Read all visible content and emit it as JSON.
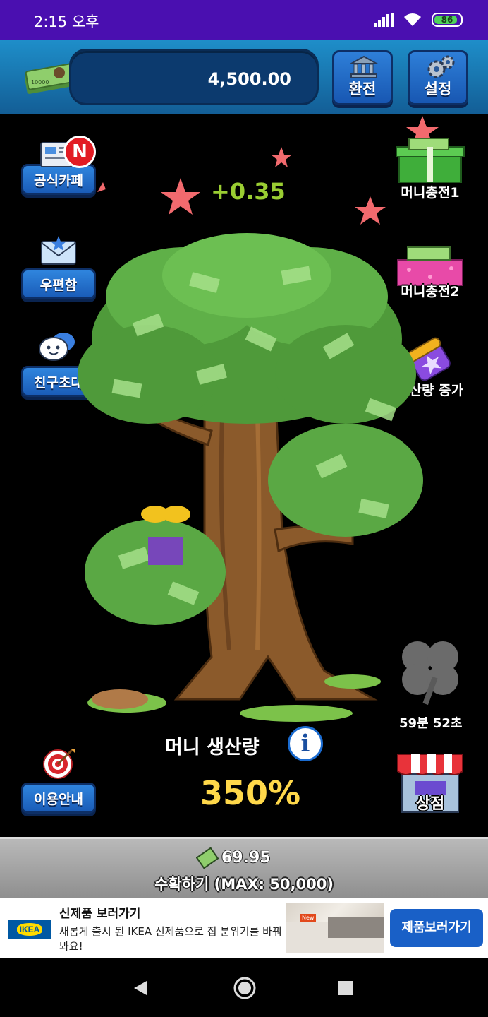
{
  "status_bar": {
    "time": "2:15 오후",
    "battery": "86"
  },
  "header": {
    "balance": "4,500.00",
    "exchange_label": "환전",
    "settings_label": "설정"
  },
  "left_menu": {
    "cafe_label": "공식카페",
    "cafe_badge": "N",
    "mailbox_label": "우편함",
    "invite_label": "친구초대",
    "guide_label": "이용안내"
  },
  "right_menu": {
    "charge1_label": "머니충전1",
    "charge2_label": "머니충전2",
    "boost_label": "생산량 증가",
    "clover_timer": "59분 52초",
    "shop_label": "상점"
  },
  "game": {
    "gain_text": "+0.35",
    "production_label": "머니 생산량",
    "info_icon": "i",
    "production_value": "350%"
  },
  "harvest": {
    "amount": "69.95",
    "label": "수확하기 (MAX: 50,000)"
  },
  "ad": {
    "brand": "IKEA",
    "title": "신제품 보러가기",
    "body": "새롭게 출시 된 IKEA 신제품으로 집 분위기를 바꿔봐요!",
    "badge": "New",
    "cta": "제품보러가기"
  },
  "colors": {
    "status_bar": "#4a0fb0",
    "header": "#1e8ec9",
    "button_blue": "#1a5cb8",
    "production_value": "#ffd84a",
    "gain_text": "#9acd32"
  },
  "icons": {
    "nav_back": "triangle-back-icon",
    "nav_home": "circle-home-icon",
    "nav_recent": "square-recent-icon"
  }
}
